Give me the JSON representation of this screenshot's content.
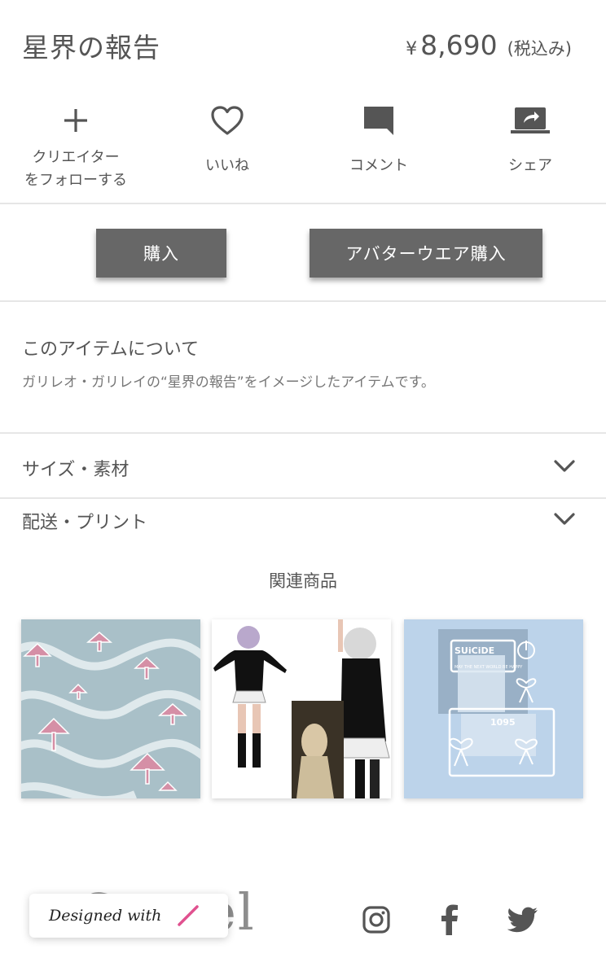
{
  "product": {
    "title": "星界の報告",
    "currency": "¥",
    "price": "8,690",
    "tax_note": "(税込み)"
  },
  "actions": [
    {
      "label": "クリエイター\nをフォローする",
      "icon": "plus-icon"
    },
    {
      "label": "いいね",
      "icon": "heart-icon"
    },
    {
      "label": "コメント",
      "icon": "comment-icon"
    },
    {
      "label": "シェア",
      "icon": "share-icon"
    }
  ],
  "buttons": {
    "buy": "購入",
    "avatar_buy": "アバターウエア購入"
  },
  "about": {
    "title": "このアイテムについて",
    "description": "ガリレオ・ガリレイの“星界の報告”をイメージしたアイテムです。"
  },
  "accordions": [
    {
      "label": "サイズ・素材"
    },
    {
      "label": "配送・プリント"
    }
  ],
  "related": {
    "title": "関連商品",
    "thumb3_text": [
      "SUiCiDE",
      "MAY THE NEXT WORLD BE HAPPY",
      "1095"
    ]
  },
  "footer": {
    "logo_text": "Sozzel",
    "designed_with": "Designed with",
    "social": [
      "instagram-icon",
      "facebook-icon",
      "twitter-icon"
    ]
  },
  "colors": {
    "text": "#555555",
    "button_bg": "#676767",
    "divider": "#e6e6e6",
    "accent_pink": "#e0518f"
  }
}
